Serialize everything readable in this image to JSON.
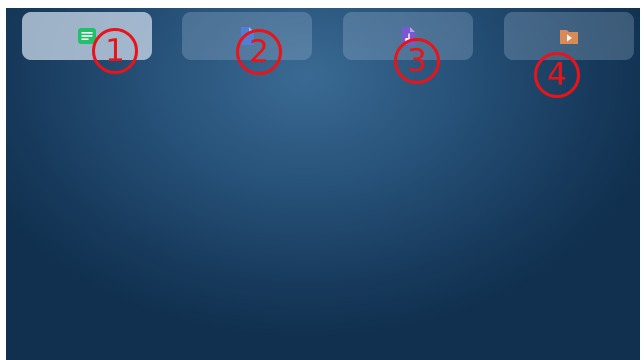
{
  "tabs": [
    {
      "icon": "notes-icon",
      "color": "#22c06a",
      "active": true,
      "marker": "1"
    },
    {
      "icon": "document-icon",
      "color": "#4f7fd6",
      "active": false,
      "marker": "2"
    },
    {
      "icon": "audio-document-icon",
      "color": "#7b57d4",
      "active": false,
      "marker": "3"
    },
    {
      "icon": "video-folder-icon",
      "color": "#d98a57",
      "active": false,
      "marker": "4"
    }
  ],
  "colors": {
    "background_center": "#3a6a93",
    "background_edge": "#11304f",
    "marker": "#e8141a"
  }
}
